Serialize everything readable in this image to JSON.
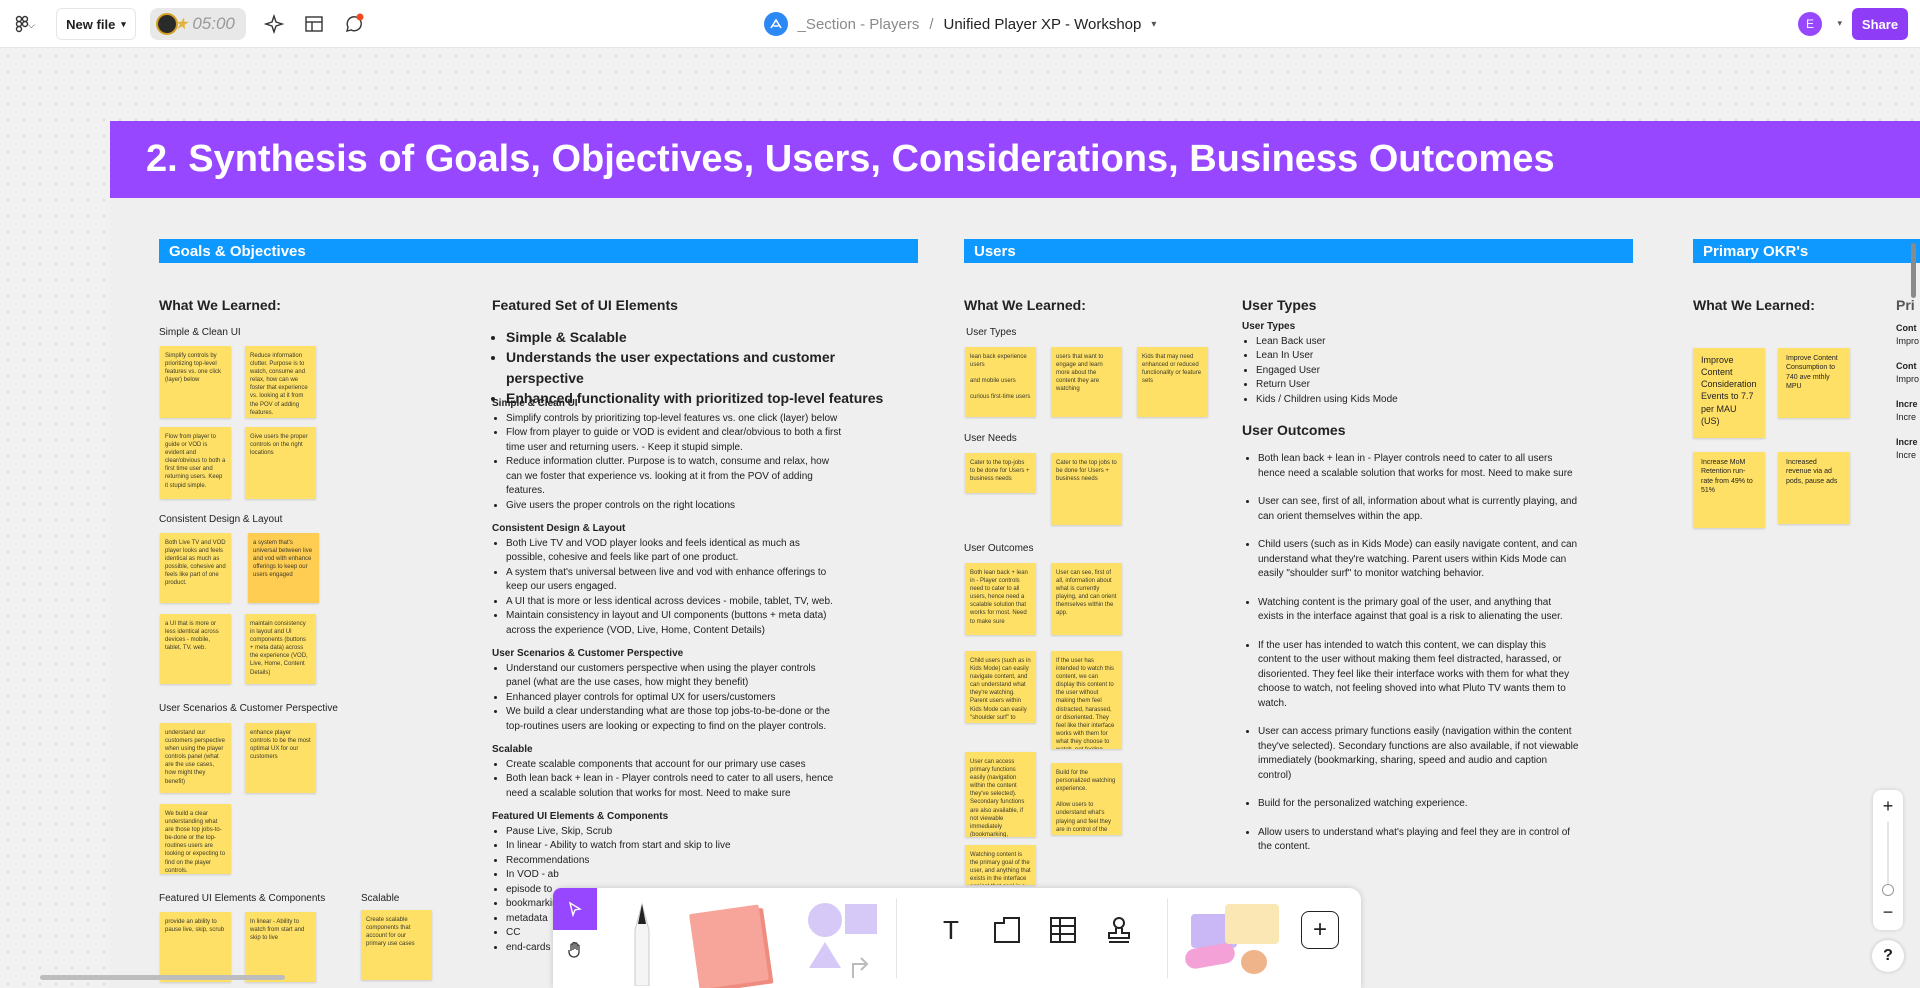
{
  "topbar": {
    "new_file_label": "New file",
    "timer": "05:00",
    "breadcrumb_section": "_Section - Players",
    "breadcrumb_separator": "/",
    "file_name": "Unified Player XP - Workshop",
    "avatar_initial": "E",
    "share_label": "Share"
  },
  "board": {
    "title": "2. Synthesis of Goals, Objectives, Users,  Considerations, Business Outcomes",
    "goals": {
      "header": "Goals & Objectives",
      "learned_title": "What We Learned:",
      "groups": [
        {
          "label": "Simple & Clean UI",
          "stickies": [
            "Simplify controls by prioritizing top-level features vs. one click (layer) below",
            "Reduce information clutter. Purpose is to watch, consume and relax, how can we foster that experience vs. looking at it from the POV of adding features.",
            "Flow from player to guide or VOD is evident and clear/obvious to both a first time user and returning users.  Keep it stupid simple.",
            "Give users the proper controls on the right locations"
          ]
        },
        {
          "label": "Consistent Design & Layout",
          "stickies": [
            "Both Live TV and VOD player looks and feels identical as much as possible, cohesive and feels like part of one product.",
            "a system that's universal between live and vod with enhance offerings to keep our users engaged",
            "a UI that is more or less identical across devices - mobile, tablet, TV, web.",
            "maintain consistency in layout and UI components (buttons + meta data) across the experience (VOD, Live, Home, Content Details)"
          ]
        },
        {
          "label": "User Scenarios & Customer Perspective",
          "stickies": [
            "understand our customers perspective when using the player controls panel (what are the use cases, how might they benefit)",
            "enhance player controls to be the most optimal UX for our customers",
            "We build a clear understanding what are those top jobs-to-be-done or the top-routines users are looking or expecting to find on the player controls."
          ]
        },
        {
          "label": "Featured UI Elements & Components",
          "stickies": [
            "provide an ability to pause live, skip, scrub",
            "In linear - Ability to watch from start and skip to live"
          ]
        },
        {
          "label": "Scalable",
          "stickies": [
            "Create scalable components that account for our primary use cases"
          ]
        }
      ],
      "featured_title": "Featured Set of UI Elements",
      "featured_bullets": [
        "Simple & Scalable",
        "Understands the user expectations and customer perspective",
        "Enhanced functionality with prioritized top-level features"
      ],
      "sections": [
        {
          "title": "Simple & Clean UI",
          "items": [
            "Simplify controls by prioritizing top-level features vs. one click (layer) below",
            "Flow from player to guide or VOD is evident and clear/obvious to both a first time user and returning users. - Keep it stupid simple.",
            "Reduce information clutter. Purpose is to watch, consume and relax, how can we foster that experience vs. looking at it from the POV of adding features.",
            "Give users the proper controls on the right locations"
          ]
        },
        {
          "title": "Consistent Design & Layout",
          "items": [
            "Both Live TV and VOD player looks and feels identical as much as possible, cohesive and feels like part of one product.",
            "A system that's universal between live and vod with enhance offerings to keep our users engaged.",
            "A UI that is more or less identical across devices - mobile, tablet, TV, web.",
            "Maintain consistency in layout and UI components (buttons + meta data) across the experience (VOD, Live, Home, Content Details)"
          ]
        },
        {
          "title": "User Scenarios & Customer Perspective",
          "items": [
            "Understand our customers perspective when using the player controls panel (what are the use cases, how might they benefit)",
            "Enhanced player controls for optimal UX for users/customers",
            "We build a clear understanding what are those top jobs-to-be-done or the top-routines users are looking or expecting to find on the player controls."
          ]
        },
        {
          "title": "Scalable",
          "items": [
            "Create scalable components that account for our primary use cases",
            "Both lean back + lean in - Player controls need to cater to all users, hence need a scalable solution that works for most. Need to make sure"
          ]
        },
        {
          "title": "Featured UI Elements & Components",
          "items": [
            "Pause Live, Skip, Scrub",
            "In linear - Ability to watch from start and skip to live",
            "Recommendations",
            "In VOD - ab",
            "episode to",
            "bookmarking",
            "metadata",
            "CC",
            "end-cards"
          ]
        }
      ]
    },
    "users": {
      "header": "Users",
      "learned_title": "What We Learned:",
      "types_label": "User Types",
      "types_stickies": [
        "lean back experience users\n\nand mobile users\n\ncurious first-time users",
        "users that want to engage and learn more about the content they are watching",
        "Kids that may need enhanced or reduced functionality or feature sets"
      ],
      "needs_label": "User Needs",
      "needs_stickies": [
        "Cater to the top-jobs to be done for Users + business needs",
        "Cater to the top jobs to be done for Users + business needs"
      ],
      "outcomes_label": "User Outcomes",
      "outcomes_stickies": [
        "Both lean back + lean in - Player controls need to cater to all users, hence need a scalable solution that works for most. Need to make sure",
        "User can see, first of all, information about what is currently playing, and can orient themselves within the app.",
        "Child users (such as in Kids Mode) can easily navigate content, and can understand what they're watching. Parent users within Kids Mode can easily \"shoulder surf\" to monitor watching behavior.",
        "If the user has intended to watch this content, we can display this content to the user without making them feel distracted, harassed, or disoriented. They feel like their interface works with them for what they choose to watch, not feeling shoved into what Pluto TV wants them to watch.",
        "User can access primary functions easily (navigation within the content they've selected). Secondary functions are also available, if not viewable immediately (bookmarking, sharing, speed and audio and caption control)",
        "Build for the personalized watching experience.\n\nAllow users to understand what's playing and feel they are in control of the content.",
        "Watching content is the primary goal of the user, and anything that exists in the interface against that goal is a risk to alienating the user."
      ],
      "user_types_title": "User Types",
      "user_types_sub": "User Types",
      "user_types_list": [
        "Lean Back user",
        "Lean In User",
        "Engaged User",
        "Return User",
        "Kids / Children using Kids Mode"
      ],
      "outcomes_title": "User Outcomes",
      "outcomes_list": [
        "Both lean back + lean in - Player controls need to cater to all users hence need a scalable solution that works for most. Need to make sure",
        "User can see, first of all, information about what is currently playing, and can orient themselves within the app.",
        "Child users (such as in Kids Mode) can easily navigate content, and can understand what they're watching. Parent users within Kids Mode can easily \"shoulder surf\" to monitor watching behavior.",
        "Watching content is the primary goal of the user, and anything that exists in the interface against that goal is a risk to alienating the user.",
        "If the user has intended to watch this content, we can display this content to the user without making them feel distracted, harassed, or disoriented. They feel like their interface works with them for what they choose to watch, not feeling shoved into what Pluto TV wants them to watch.",
        "User can access primary functions easily (navigation within the content they've selected). Secondary functions are also available, if not viewable immediately (bookmarking, sharing, speed and audio and caption control)",
        "Build for the personalized watching experience.",
        "Allow users to understand what's playing and feel they are in control of the content."
      ]
    },
    "okr": {
      "header": "Primary OKR's",
      "learned_title": "What We Learned:",
      "stickies": [
        "Improve Content Consideration Events to 7.7 per MAU (US)",
        "Improve Content Consumption to 740 ave mthly MPU",
        "Increase MoM Retention run-rate from 49% to 51%",
        "Increased revenue via ad pods, pause ads"
      ],
      "right_title": "Pri",
      "right_items": [
        [
          "Cont",
          "Impro"
        ],
        [
          "Cont",
          "Impro"
        ],
        [
          "Incre",
          "Incre"
        ],
        [
          "Incre",
          "Incre"
        ]
      ]
    }
  },
  "toolbar": {
    "tools": [
      "move-tool",
      "hand-tool",
      "pen-tool",
      "sticky-tool",
      "shape-tool",
      "text-tool",
      "section-tool",
      "table-tool",
      "stamp-tool",
      "widgets-tool",
      "add-tool"
    ],
    "text_icon": "T",
    "plus_icon": "+"
  },
  "zoom": {
    "in": "+",
    "out": "−"
  },
  "help": "?",
  "colors": {
    "purple": "#9747FF",
    "blue": "#0D99FF",
    "sticky": "#FFE066",
    "share": "#8F3CF7"
  }
}
